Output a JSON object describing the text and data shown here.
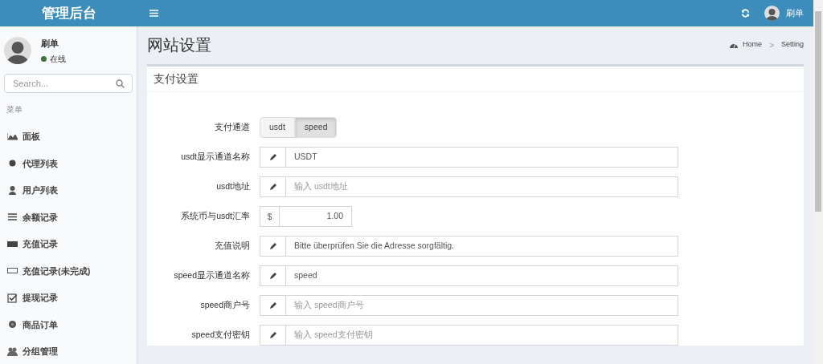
{
  "header": {
    "title": "管理后台",
    "user": "刷单"
  },
  "sidebar": {
    "user": {
      "name": "刷单",
      "status": "在线",
      "online": true
    },
    "search": {
      "placeholder": "Search..."
    },
    "section": "菜单",
    "items": [
      {
        "label": "面板"
      },
      {
        "label": "代理列表"
      },
      {
        "label": "用户列表"
      },
      {
        "label": "余额记录"
      },
      {
        "label": "充值记录"
      },
      {
        "label": "充值记录(未完成)"
      },
      {
        "label": "提现记录"
      },
      {
        "label": "商品订单"
      },
      {
        "label": "分组管理"
      }
    ]
  },
  "page": {
    "title": "网站设置",
    "breadcrumb": [
      "Home",
      "Setting"
    ],
    "breadcrumb_separator": ">"
  },
  "panel": {
    "title": "支付设置",
    "fields": [
      {
        "kind": "toggle",
        "label": "支付通道",
        "options": [
          {
            "label": "usdt",
            "selected": false
          },
          {
            "label": "speed",
            "selected": true
          }
        ]
      },
      {
        "kind": "text",
        "label": "usdt显示通道名称",
        "value": "USDT"
      },
      {
        "kind": "text",
        "label": "usdt地址",
        "placeholder": "输入 usdt地址"
      },
      {
        "kind": "money",
        "label": "系统币与usdt汇率",
        "prefix": "$",
        "value": "1.00"
      },
      {
        "kind": "text",
        "label": "充值说明",
        "value": "Bitte überprüfen Sie die Adresse sorgfältig."
      },
      {
        "kind": "text",
        "label": "speed显示通道名称",
        "value": "speed"
      },
      {
        "kind": "text",
        "label": "speed商户号",
        "placeholder": "输入 speed商户号"
      },
      {
        "kind": "text",
        "label": "speed支付密钥",
        "placeholder": "输入 speed支付密钥"
      }
    ]
  }
}
